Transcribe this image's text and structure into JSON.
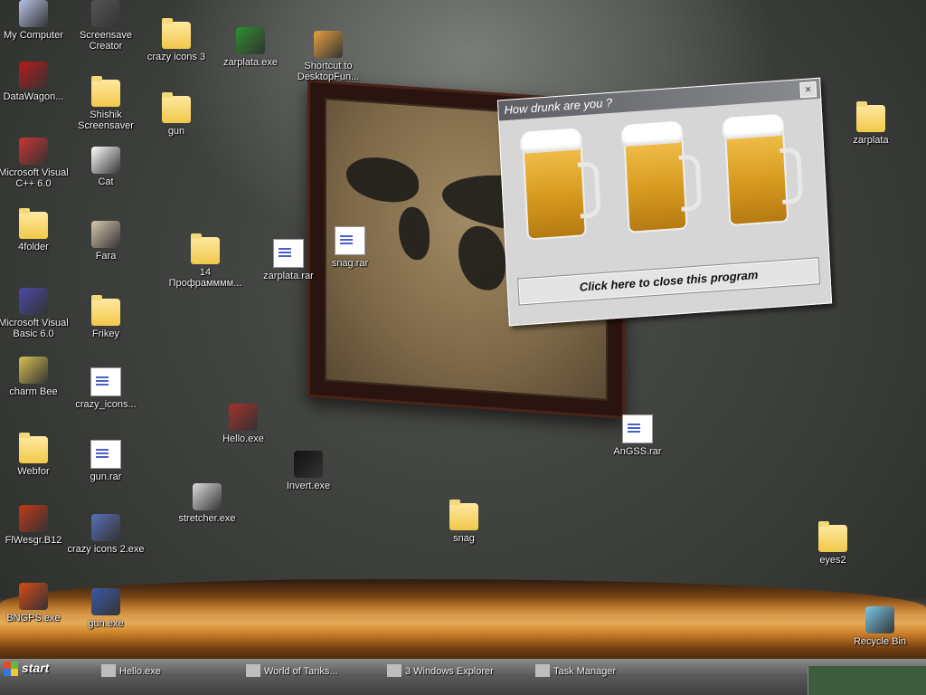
{
  "desktop_icons": [
    {
      "label": "My Computer",
      "type": "exe",
      "color": "#b8c4e6"
    },
    {
      "label": "Screensave Creator",
      "type": "exe",
      "color": "#555555"
    },
    {
      "label": "crazy icons 3",
      "type": "folder"
    },
    {
      "label": "zarplata.exe",
      "type": "exe",
      "color": "#2e8f2e"
    },
    {
      "label": "Shortcut to DesktopFun...",
      "type": "exe",
      "color": "#e8a040"
    },
    {
      "label": "DataWagon...",
      "type": "exe",
      "color": "#b81a1a"
    },
    {
      "label": "Shishik Screensaver",
      "type": "folder"
    },
    {
      "label": "gun",
      "type": "folder"
    },
    {
      "label": "zarplata",
      "type": "folder"
    },
    {
      "label": "Microsoft Visual C++ 6.0",
      "type": "exe",
      "color": "#c33"
    },
    {
      "label": "Cat",
      "type": "exe",
      "color": "#ffffff"
    },
    {
      "label": "4folder",
      "type": "folder"
    },
    {
      "label": "Fara",
      "type": "exe",
      "color": "#d8c8b0"
    },
    {
      "label": "14 Профрамммм...",
      "type": "folder"
    },
    {
      "label": "zarplata.rar",
      "type": "doc"
    },
    {
      "label": "snag.rar",
      "type": "doc"
    },
    {
      "label": "Microsoft Visual Basic 6.0",
      "type": "exe",
      "color": "#4a4aa8"
    },
    {
      "label": "Frikey",
      "type": "folder"
    },
    {
      "label": "charm Bee",
      "type": "exe",
      "color": "#d8c050"
    },
    {
      "label": "crazy_icons...",
      "type": "doc"
    },
    {
      "label": "Hello.exe",
      "type": "exe",
      "color": "#a4302c"
    },
    {
      "label": "AnGSS.rar",
      "type": "doc"
    },
    {
      "label": "Webfor",
      "type": "folder"
    },
    {
      "label": "gun.rar",
      "type": "doc"
    },
    {
      "label": "Invert.exe",
      "type": "exe",
      "color": "#111111"
    },
    {
      "label": "stretcher.exe",
      "type": "exe",
      "color": "#dddddd"
    },
    {
      "label": "snag",
      "type": "folder"
    },
    {
      "label": "eyes2",
      "type": "folder"
    },
    {
      "label": "FlWesgr.B12",
      "type": "exe",
      "color": "#c33818"
    },
    {
      "label": "crazy icons 2.exe",
      "type": "exe",
      "color": "#5870b8"
    },
    {
      "label": "BNGPS.exe",
      "type": "exe",
      "color": "#d84a18"
    },
    {
      "label": "gun.exe",
      "type": "exe",
      "color": "#3a5aa8"
    },
    {
      "label": "Recycle Bin",
      "type": "exe",
      "color": "#7ac8e8"
    }
  ],
  "popup": {
    "title": "How drunk are you ?",
    "close_glyph": "×",
    "button_label": "Click here to close this program"
  },
  "taskbar": {
    "start_label": "start",
    "tasks": [
      "Hello.exe",
      "World of Tanks...",
      "3 Windows Explorer",
      "Task Manager"
    ]
  }
}
